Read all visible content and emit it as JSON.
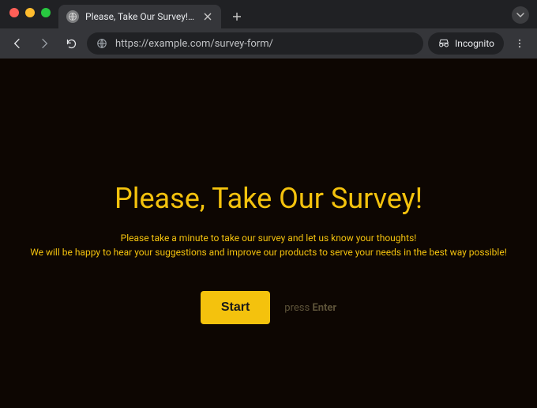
{
  "browser": {
    "tab_title": "Please, Take Our Survey! – Fl…",
    "url": "https://example.com/survey-form/",
    "incognito_label": "Incognito"
  },
  "page": {
    "heading": "Please, Take Our Survey!",
    "line1": "Please take a minute to take our survey and let us know your thoughts!",
    "line2": "We will be happy to hear your suggestions and improve our products to serve your needs in the best way possible!",
    "start_label": "Start",
    "hint_prefix": "press ",
    "hint_key": "Enter"
  }
}
